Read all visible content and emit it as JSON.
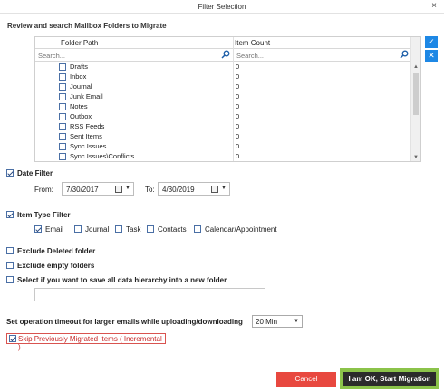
{
  "window": {
    "title": "Filter Selection",
    "close_label": "×"
  },
  "folders_section": {
    "title": "Review and search Mailbox Folders to Migrate",
    "columns": {
      "path": "Folder Path",
      "count": "Item Count"
    },
    "search": {
      "path_placeholder": "Search...",
      "count_placeholder": "Search..."
    },
    "rows": [
      {
        "name": "Drafts",
        "count": "0"
      },
      {
        "name": "Inbox",
        "count": "0"
      },
      {
        "name": "Journal",
        "count": "0"
      },
      {
        "name": "Junk Email",
        "count": "0"
      },
      {
        "name": "Notes",
        "count": "0"
      },
      {
        "name": "Outbox",
        "count": "0"
      },
      {
        "name": "RSS Feeds",
        "count": "0"
      },
      {
        "name": "Sent Items",
        "count": "0"
      },
      {
        "name": "Sync Issues",
        "count": "0"
      },
      {
        "name": "Sync Issues\\Conflicts",
        "count": "0"
      }
    ],
    "side_buttons": {
      "select_all": "✓",
      "clear": "✕"
    }
  },
  "date_filter": {
    "label": "Date Filter",
    "checked": true,
    "from_label": "From:",
    "from_value": "7/30/2017",
    "to_label": "To:",
    "to_value": "4/30/2019"
  },
  "item_type_filter": {
    "label": "Item Type Filter",
    "checked": true,
    "types": [
      {
        "label": "Email",
        "checked": true
      },
      {
        "label": "Journal",
        "checked": false
      },
      {
        "label": "Task",
        "checked": false
      },
      {
        "label": "Contacts",
        "checked": false
      },
      {
        "label": "Calendar/Appointment",
        "checked": false
      }
    ]
  },
  "options": {
    "exclude_deleted": "Exclude Deleted folder",
    "exclude_empty": "Exclude empty folders",
    "save_hierarchy": "Select if you want to save all data hierarchy into a new folder",
    "hierarchy_folder_value": ""
  },
  "timeout": {
    "label": "Set operation timeout for larger emails while uploading/downloading",
    "value": "20 Min"
  },
  "skip_migrated": {
    "label": "Skip Previously Migrated Items ( Incremental )",
    "checked": true
  },
  "buttons": {
    "cancel": "Cancel",
    "start": "I am OK, Start Migration"
  },
  "colors": {
    "accent": "#1e88e5",
    "cancel": "#e8483f",
    "start": "#2b2b2b",
    "highlight": "#8bc34a"
  }
}
